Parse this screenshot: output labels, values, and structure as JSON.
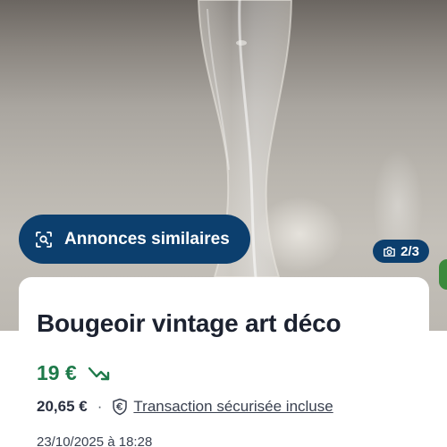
{
  "gallery": {
    "similar_label": "Annonces similaires",
    "similar_icon": "visual-search-icon",
    "counter": "2/3",
    "counter_icon": "camera-icon"
  },
  "listing": {
    "title": "Bougeoir vintage art déco",
    "price": "19 €",
    "price_trend_icon": "price-drop-icon",
    "total_price": "20,65 €",
    "separator": "·",
    "protection_icon": "shield-euro-icon",
    "protection_label": "Transaction sécurisée incluse",
    "date": "23/10/2025 à 18:28"
  },
  "colors": {
    "accent_navy": "#0c3f6e",
    "price_green": "#1e7a4a",
    "title_text": "#1c2230"
  }
}
